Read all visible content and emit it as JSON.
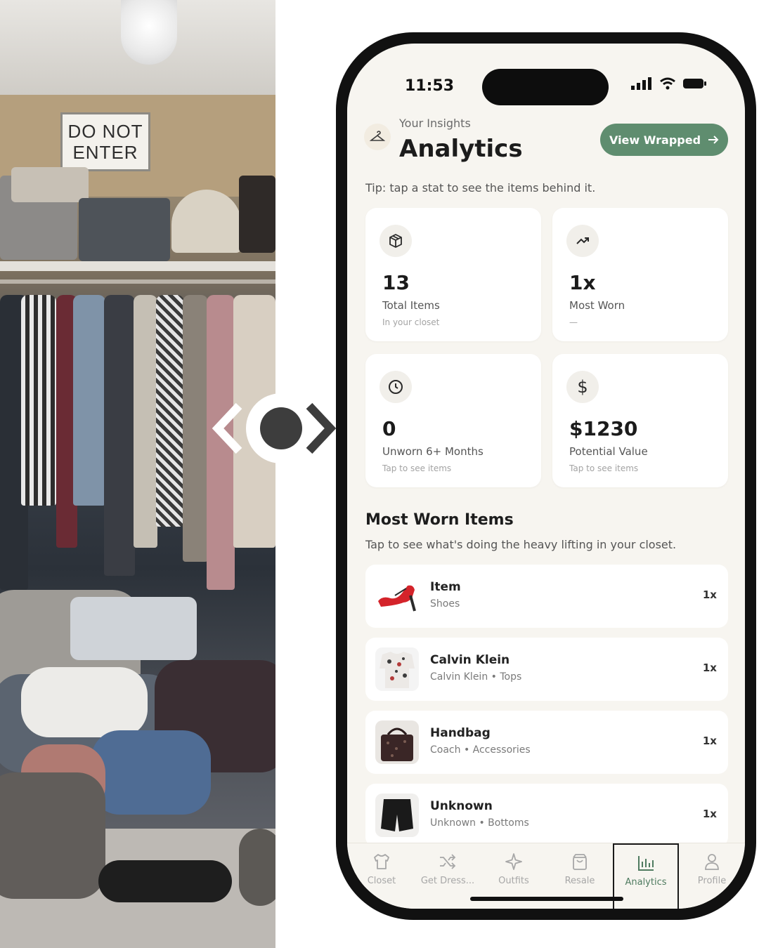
{
  "photo": {
    "sign_line1": "DO NOT",
    "sign_line2": "ENTER"
  },
  "status_bar": {
    "time": "11:53"
  },
  "header": {
    "eyebrow": "Your Insights",
    "title": "Analytics",
    "wrapped_button": "View Wrapped"
  },
  "tip": "Tip: tap a stat to see the items behind it.",
  "stats": [
    {
      "value": "13",
      "label": "Total Items",
      "sub": "In your closet",
      "icon": "box-icon"
    },
    {
      "value": "1x",
      "label": "Most Worn",
      "sub": "—",
      "icon": "trend-up-icon"
    },
    {
      "value": "0",
      "label": "Unworn 6+ Months",
      "sub": "Tap to see items",
      "icon": "clock-icon"
    },
    {
      "value": "$1230",
      "label": "Potential Value",
      "sub": "Tap to see items",
      "icon": "dollar-icon"
    }
  ],
  "most_worn": {
    "title": "Most Worn Items",
    "subtitle": "Tap to see what's doing the heavy lifting in your closet.",
    "items": [
      {
        "name": "Item",
        "meta": "Shoes",
        "count": "1x"
      },
      {
        "name": "Calvin Klein",
        "meta": "Calvin Klein • Tops",
        "count": "1x"
      },
      {
        "name": "Handbag",
        "meta": "Coach • Accessories",
        "count": "1x"
      },
      {
        "name": "Unknown",
        "meta": "Unknown • Bottoms",
        "count": "1x"
      }
    ]
  },
  "tabs": [
    {
      "label": "Closet",
      "icon": "shirt-icon"
    },
    {
      "label": "Get Dress...",
      "icon": "shuffle-icon"
    },
    {
      "label": "Outfits",
      "icon": "sparkle-icon"
    },
    {
      "label": "Resale",
      "icon": "bag-icon"
    },
    {
      "label": "Analytics",
      "icon": "bar-chart-icon",
      "active": true
    },
    {
      "label": "Profile",
      "icon": "person-icon"
    }
  ],
  "colors": {
    "accent": "#5f8d6f",
    "background": "#f7f5f0",
    "card": "#ffffff"
  }
}
